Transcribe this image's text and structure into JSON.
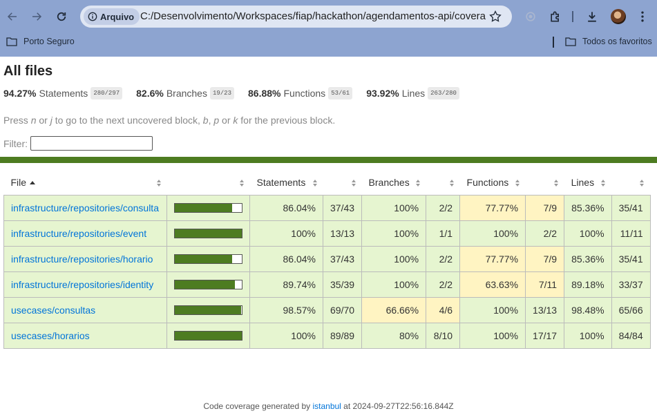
{
  "browser": {
    "site_chip": "Arquivo",
    "url": "C:/Desenvolvimento/Workspaces/fiap/hackathon/agendamentos-api/coverag...",
    "bookmarks": [
      {
        "label": "Porto Seguro",
        "icon": "folder-icon"
      },
      {
        "label": "Todos os favoritos",
        "icon": "folder-icon"
      }
    ]
  },
  "page": {
    "title": "All files",
    "summary": [
      {
        "pct": "94.27%",
        "label": "Statements",
        "frac": "280/297"
      },
      {
        "pct": "82.6%",
        "label": "Branches",
        "frac": "19/23"
      },
      {
        "pct": "86.88%",
        "label": "Functions",
        "frac": "53/61"
      },
      {
        "pct": "93.92%",
        "label": "Lines",
        "frac": "263/280"
      }
    ],
    "help": {
      "t1": "Press ",
      "k1": "n",
      "t2": " or ",
      "k2": "j",
      "t3": " to go to the next uncovered block, ",
      "k3": "b",
      "t4": ", ",
      "k4": "p",
      "t5": " or ",
      "k5": "k",
      "t6": " for the previous block."
    },
    "filter_label": "Filter:",
    "table": {
      "headers": {
        "file": "File",
        "statements": "Statements",
        "branches": "Branches",
        "functions": "Functions",
        "lines": "Lines"
      },
      "rows": [
        {
          "file": "infrastructure/repositories/consulta",
          "coverage": 0.86,
          "stmt_pct": "86.04%",
          "stmt_frac": "37/43",
          "br_pct": "100%",
          "br_frac": "2/2",
          "fn_pct": "77.77%",
          "fn_frac": "7/9",
          "ln_pct": "85.36%",
          "ln_frac": "35/41",
          "br_level": "high",
          "fn_level": "medium"
        },
        {
          "file": "infrastructure/repositories/event",
          "coverage": 1.0,
          "stmt_pct": "100%",
          "stmt_frac": "13/13",
          "br_pct": "100%",
          "br_frac": "1/1",
          "fn_pct": "100%",
          "fn_frac": "2/2",
          "ln_pct": "100%",
          "ln_frac": "11/11",
          "br_level": "high",
          "fn_level": "high"
        },
        {
          "file": "infrastructure/repositories/horario",
          "coverage": 0.86,
          "stmt_pct": "86.04%",
          "stmt_frac": "37/43",
          "br_pct": "100%",
          "br_frac": "2/2",
          "fn_pct": "77.77%",
          "fn_frac": "7/9",
          "ln_pct": "85.36%",
          "ln_frac": "35/41",
          "br_level": "high",
          "fn_level": "medium"
        },
        {
          "file": "infrastructure/repositories/identity",
          "coverage": 0.897,
          "stmt_pct": "89.74%",
          "stmt_frac": "35/39",
          "br_pct": "100%",
          "br_frac": "2/2",
          "fn_pct": "63.63%",
          "fn_frac": "7/11",
          "ln_pct": "89.18%",
          "ln_frac": "33/37",
          "br_level": "high",
          "fn_level": "medium"
        },
        {
          "file": "usecases/consultas",
          "coverage": 0.985,
          "stmt_pct": "98.57%",
          "stmt_frac": "69/70",
          "br_pct": "66.66%",
          "br_frac": "4/6",
          "fn_pct": "100%",
          "fn_frac": "13/13",
          "ln_pct": "98.48%",
          "ln_frac": "65/66",
          "br_level": "medium",
          "fn_level": "high"
        },
        {
          "file": "usecases/horarios",
          "coverage": 1.0,
          "stmt_pct": "100%",
          "stmt_frac": "89/89",
          "br_pct": "80%",
          "br_frac": "8/10",
          "fn_pct": "100%",
          "fn_frac": "17/17",
          "ln_pct": "100%",
          "ln_frac": "84/84",
          "br_level": "high",
          "fn_level": "high"
        }
      ]
    },
    "footer": {
      "prefix": "Code coverage generated by ",
      "link": "istanbul",
      "suffix": " at 2024-09-27T22:56:16.844Z"
    }
  }
}
